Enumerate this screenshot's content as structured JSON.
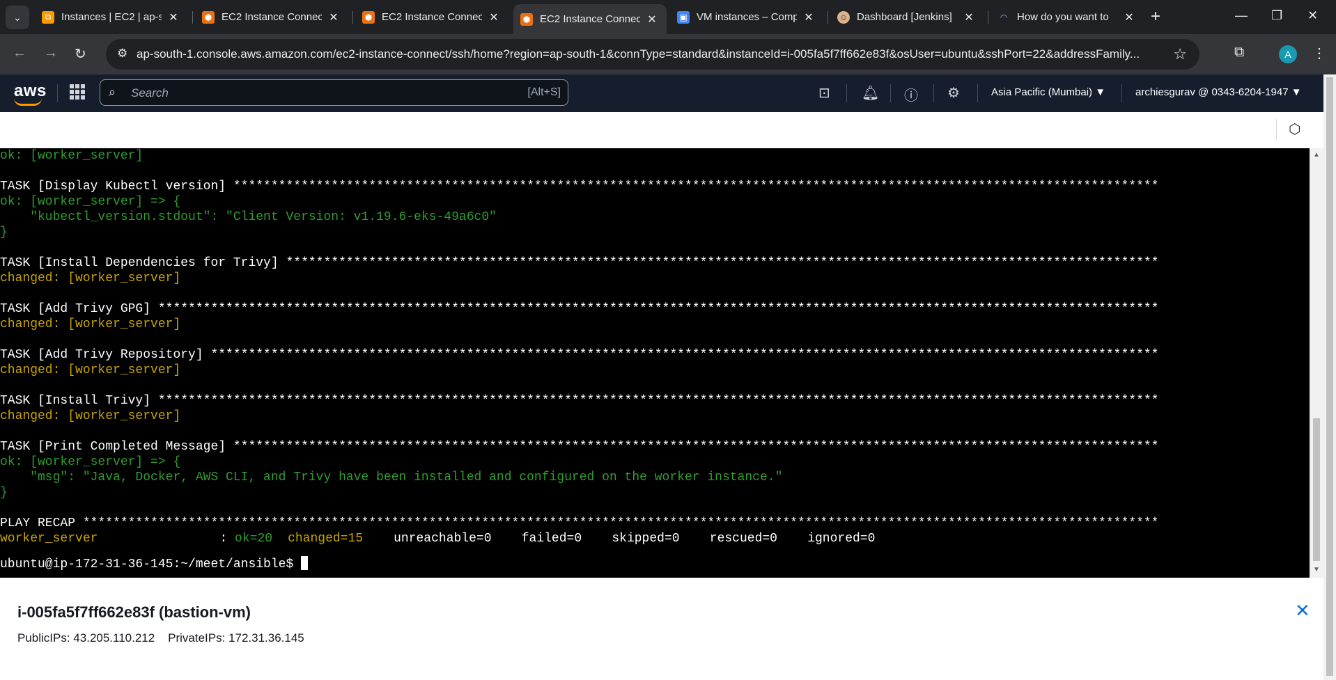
{
  "browser": {
    "tabs": [
      {
        "title": "Instances | EC2 | ap-s",
        "active": false,
        "icon": "aws-ec2-icon"
      },
      {
        "title": "EC2 Instance Connect",
        "active": false,
        "icon": "aws-cube-icon"
      },
      {
        "title": "EC2 Instance Connect",
        "active": false,
        "icon": "aws-cube-icon"
      },
      {
        "title": "EC2 Instance Connect",
        "active": true,
        "icon": "aws-cube-icon"
      },
      {
        "title": "VM instances – Comp",
        "active": false,
        "icon": "gcp-compute-icon"
      },
      {
        "title": "Dashboard [Jenkins]",
        "active": false,
        "icon": "jenkins-icon"
      },
      {
        "title": "How do you want to",
        "active": false,
        "icon": "wave-icon"
      }
    ],
    "url": "ap-south-1.console.aws.amazon.com/ec2-instance-connect/ssh/home?region=ap-south-1&connType=standard&instanceId=i-005fa5f7ff662e83f&osUser=ubuntu&sshPort=22&addressFamily...",
    "profile_initial": "A"
  },
  "aws_header": {
    "logo": "aws",
    "search_placeholder": "Search",
    "search_shortcut": "[Alt+S]",
    "region": "Asia Pacific (Mumbai) ▼",
    "account": "archiesgurav @ 0343-6204-1947 ▼"
  },
  "terminal": {
    "lines": [
      {
        "text": "ok: [worker_server]",
        "color": "green"
      },
      {
        "text": "",
        "color": "white"
      },
      {
        "text": "TASK [Display Kubectl version] ***************************************************************************************************************************",
        "color": "white"
      },
      {
        "text": "ok: [worker_server] => {",
        "color": "green"
      },
      {
        "text": "    \"kubectl_version.stdout\": \"Client Version: v1.19.6-eks-49a6c0\"",
        "color": "green"
      },
      {
        "text": "}",
        "color": "green"
      },
      {
        "text": "",
        "color": "white"
      },
      {
        "text": "TASK [Install Dependencies for Trivy] ********************************************************************************************************************",
        "color": "white"
      },
      {
        "text": "changed: [worker_server]",
        "color": "yellow"
      },
      {
        "text": "",
        "color": "white"
      },
      {
        "text": "TASK [Add Trivy GPG] *************************************************************************************************************************************",
        "color": "white"
      },
      {
        "text": "changed: [worker_server]",
        "color": "yellow"
      },
      {
        "text": "",
        "color": "white"
      },
      {
        "text": "TASK [Add Trivy Repository] ******************************************************************************************************************************",
        "color": "white"
      },
      {
        "text": "changed: [worker_server]",
        "color": "yellow"
      },
      {
        "text": "",
        "color": "white"
      },
      {
        "text": "TASK [Install Trivy] *************************************************************************************************************************************",
        "color": "white"
      },
      {
        "text": "changed: [worker_server]",
        "color": "yellow"
      },
      {
        "text": "",
        "color": "white"
      },
      {
        "text": "TASK [Print Completed Message] ***************************************************************************************************************************",
        "color": "white"
      },
      {
        "text": "ok: [worker_server] => {",
        "color": "green"
      },
      {
        "text": "    \"msg\": \"Java, Docker, AWS CLI, and Trivy have been installed and configured on the worker instance.\"",
        "color": "green"
      },
      {
        "text": "}",
        "color": "green"
      },
      {
        "text": "",
        "color": "white"
      },
      {
        "text": "PLAY RECAP ***********************************************************************************************************************************************",
        "color": "white"
      }
    ],
    "recap": {
      "host": "worker_server",
      "colon": ": ",
      "ok": "ok=20",
      "changed": "changed=15",
      "rest": "unreachable=0    failed=0    skipped=0    rescued=0    ignored=0"
    },
    "prompt": "ubuntu@ip-172-31-36-145:~/meet/ansible$ "
  },
  "instance": {
    "title": "i-005fa5f7ff662e83f (bastion-vm)",
    "ips": "PublicIPs: 43.205.110.212    PrivateIPs: 172.31.36.145"
  },
  "colors": {
    "terminal_bg": "#000000",
    "ok_green": "#2f9e2f",
    "changed_yellow": "#c9a400",
    "aws_nav": "#161e2d",
    "link_blue": "#0972d3"
  }
}
